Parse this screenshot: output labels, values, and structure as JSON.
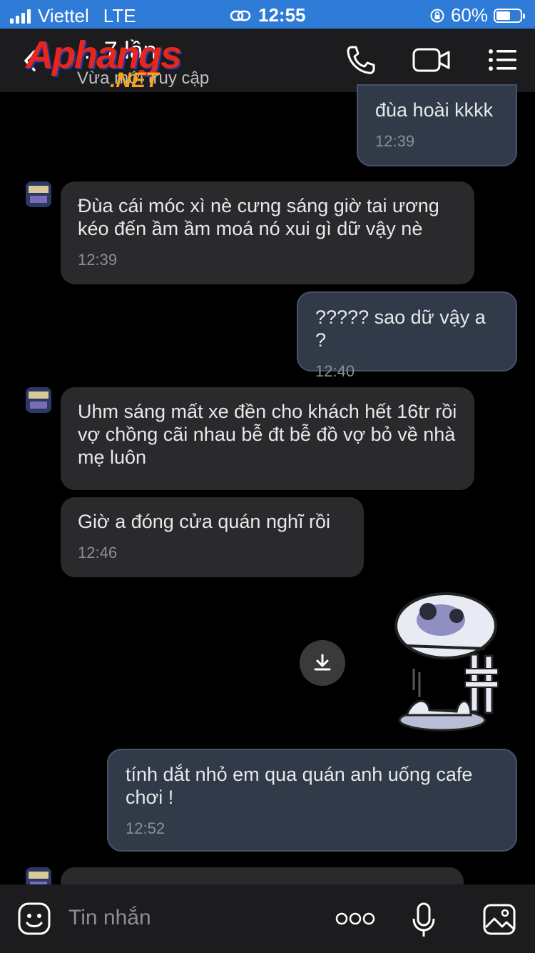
{
  "status_bar": {
    "carrier": "Viettel",
    "network": "LTE",
    "time": "12:55",
    "battery_percent": "60%",
    "battery_level": 0.6
  },
  "header": {
    "title": "... 7 lần",
    "subtitle": "Vừa mới truy cập",
    "watermark_brand": "Aphangs",
    "watermark_suffix": ".NET"
  },
  "messages": [
    {
      "id": "m1",
      "direction": "out",
      "text": "đùa hoài kkkk",
      "time": "12:39"
    },
    {
      "id": "m2",
      "direction": "in",
      "text": "Đùa cái móc xì nè cưng sáng giờ tai ương kéo đến ầm ầm moá nó xui gì dữ vậy nè",
      "time": "12:39"
    },
    {
      "id": "m3",
      "direction": "out",
      "text": "????? sao dữ vậy a ?",
      "time": "12:40"
    },
    {
      "id": "m4",
      "direction": "in",
      "text": "Uhm sáng mất xe đền cho khách hết 16tr rồi vợ chồng cãi nhau bễ đt bễ đồ vợ bỏ về nhà mẹ luôn",
      "time": ""
    },
    {
      "id": "m5",
      "direction": "in",
      "text": "Giờ a đóng cửa quán nghĩ rồi",
      "time": "12:46"
    },
    {
      "id": "m6",
      "direction": "out",
      "text": "tính dắt nhỏ em qua quán anh uống cafe chơi !",
      "time": "12:52"
    }
  ],
  "composer": {
    "placeholder": "Tin nhắn"
  },
  "colors": {
    "status_bar": "#2f7bd8",
    "outgoing_bubble": "#303a48",
    "incoming_bubble": "#2a2a2c",
    "background": "#000000"
  },
  "icons": [
    "back-icon",
    "phone-icon",
    "video-call-icon",
    "menu-icon",
    "download-icon",
    "sticker-icon",
    "emoji-icon",
    "more-icon",
    "microphone-icon",
    "image-icon"
  ]
}
